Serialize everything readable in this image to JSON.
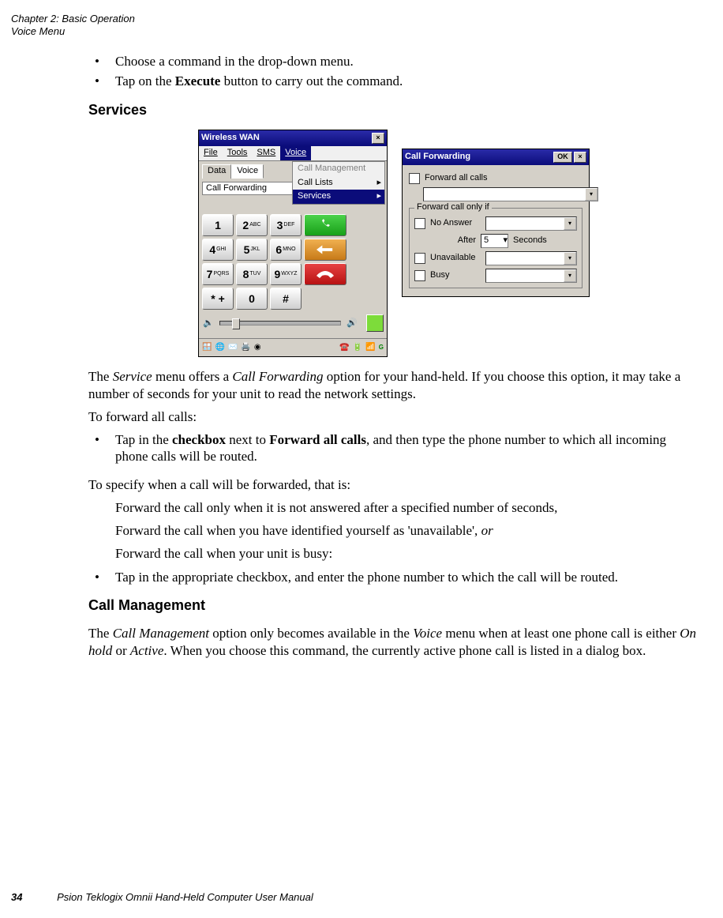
{
  "header": {
    "chapter": "Chapter 2:  Basic Operation",
    "section": "Voice Menu"
  },
  "intro_bullets": [
    "Choose a command in the drop-down menu.",
    "Tap on the <b>Execute</b> button to carry out the command."
  ],
  "services_title": "Services",
  "wwan": {
    "title": "Wireless WAN",
    "menubar": {
      "file": "File",
      "tools": "Tools",
      "sms": "SMS",
      "voice": "Voice"
    },
    "tabs": {
      "data": "Data",
      "voice": "Voice"
    },
    "cf_line": "Call Forwarding",
    "dropdown": {
      "mgmt": "Call Management",
      "lists": "Call Lists",
      "services": "Services"
    },
    "keys": {
      "k1": "1",
      "k2": "2",
      "k2s": "ABC",
      "k3": "3",
      "k3s": "DEF",
      "k4": "4",
      "k4s": "GHI",
      "k5": "5",
      "k5s": "JKL",
      "k6": "6",
      "k6s": "MNO",
      "k7": "7",
      "k7s": "PQRS",
      "k8": "8",
      "k8s": "TUV",
      "k9": "9",
      "k9s": "WXYZ",
      "star": "* +",
      "k0": "0",
      "hash": "#"
    }
  },
  "cfw": {
    "title": "Call Forwarding",
    "ok": "OK",
    "forward_all": "Forward all calls",
    "legend": "Forward call only if",
    "noanswer": "No Answer",
    "after": "After",
    "after_val": "5",
    "seconds": "Seconds",
    "unavailable": "Unavailable",
    "busy": "Busy"
  },
  "para1_a": "The ",
  "para1_b": "Service",
  "para1_c": " menu offers a ",
  "para1_d": "Call Forwarding",
  "para1_e": " option for your hand-held. If you choose this option, it may take a number of seconds for your unit to read the network settings.",
  "para2": "To forward all calls:",
  "bullet2_a": "Tap in the ",
  "bullet2_b": "checkbox",
  "bullet2_c": " next to ",
  "bullet2_d": "Forward all calls",
  "bullet2_e": ", and then type the phone number to which all incoming phone calls will be routed.",
  "para3": "To specify when a call will be forwarded, that is:",
  "ind1": "Forward the call only when it is not answered after a specified number of seconds,",
  "ind2_a": "Forward the call when you have identified yourself as 'unavailable', ",
  "ind2_b": "or",
  "ind3": "Forward the call when your unit is busy:",
  "bullet3": "Tap in the appropriate checkbox, and enter the phone number to which the call will be routed.",
  "cm_title": "Call Management",
  "cm_a": "The ",
  "cm_b": "Call Management",
  "cm_c": " option only becomes available in the ",
  "cm_d": "Voice",
  "cm_e": " menu when at least one phone call is either ",
  "cm_f": "On hold",
  "cm_g": " or ",
  "cm_h": "Active",
  "cm_i": ". When you choose this command, the currently active phone call is listed in a dialog box.",
  "footer": {
    "page": "34",
    "text": "Psion Teklogix Omnii Hand-Held Computer User Manual"
  }
}
